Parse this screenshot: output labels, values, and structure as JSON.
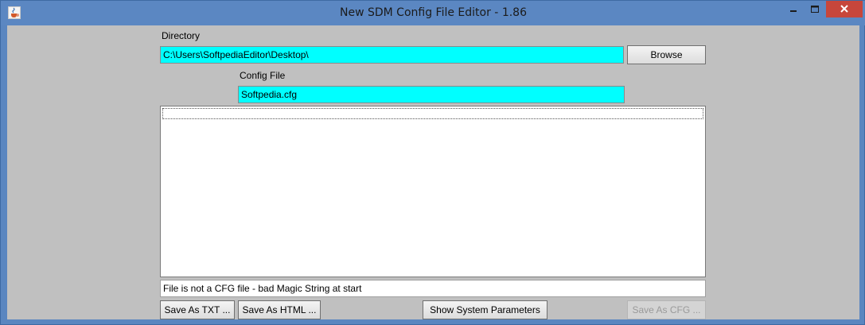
{
  "window": {
    "title": "New SDM Config File Editor - 1.86"
  },
  "directory": {
    "label": "Directory",
    "value": "C:\\Users\\SoftpediaEditor\\Desktop\\",
    "browse_label": "Browse"
  },
  "config_file": {
    "label": "Config File",
    "value": "Softpedia.cfg"
  },
  "editor": {
    "content": ""
  },
  "status": {
    "message": "File is not a CFG file - bad Magic String at start"
  },
  "buttons": {
    "save_txt": "Save As TXT ...",
    "save_html": "Save As HTML ...",
    "show_params": "Show System Parameters",
    "save_cfg": "Save As CFG ..."
  },
  "colors": {
    "field_bg": "#00ffff",
    "client_bg": "#c0c0c0",
    "titlebar": "#5b87c2",
    "close_button": "#c7463b"
  },
  "icons": {
    "app": "java-cup-icon",
    "minimize": "minimize-icon",
    "maximize": "maximize-icon",
    "close": "close-icon"
  }
}
